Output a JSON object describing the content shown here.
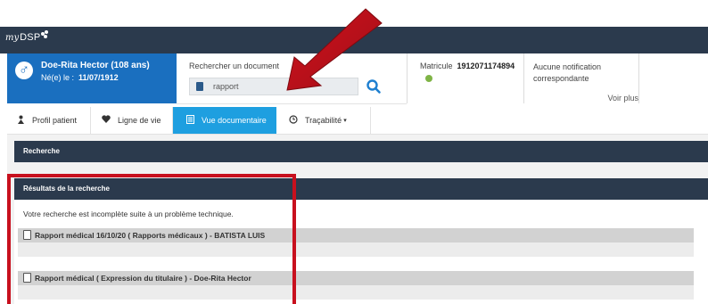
{
  "app": {
    "logo_text": "my DSP"
  },
  "patient": {
    "gender_icon": "male-symbol-icon",
    "name": "Doe-Rita Hector (108 ans)",
    "birth_label": "Né(e) le :",
    "birth_date": "11/07/1912"
  },
  "search": {
    "label": "Rechercher un document",
    "value": "rapport",
    "icon": "search-icon"
  },
  "matricule": {
    "label": "Matricule",
    "value": "1912071174894",
    "status_color": "#7fb446"
  },
  "notifications": {
    "text": "Aucune notification correspondante",
    "more_link": "Voir plus"
  },
  "tabs": [
    {
      "label": "Profil patient",
      "icon": "person-icon"
    },
    {
      "label": "Ligne de vie",
      "icon": "heart-icon"
    },
    {
      "label": "Vue documentaire",
      "icon": "document-icon",
      "active": true
    },
    {
      "label": "Traçabilité",
      "icon": "clock-icon",
      "dropdown": true
    }
  ],
  "sections": {
    "search_title": "Recherche",
    "results_title": "Résultats de la recherche"
  },
  "results": {
    "message": "Votre recherche est incomplète suite à un problème technique.",
    "items": [
      {
        "title": "Rapport médical 16/10/20 ( Rapports médicaux ) - BATISTA LUIS",
        "icon": "file-icon"
      },
      {
        "title": "Rapport médical ( Expression du titulaire ) - Doe-Rita Hector",
        "icon": "file-icon"
      }
    ]
  },
  "colors": {
    "topbar": "#2b3a4d",
    "patient_box": "#1a6fbf",
    "active_tab": "#1e9fe0",
    "annotation_red": "#c8101e"
  }
}
